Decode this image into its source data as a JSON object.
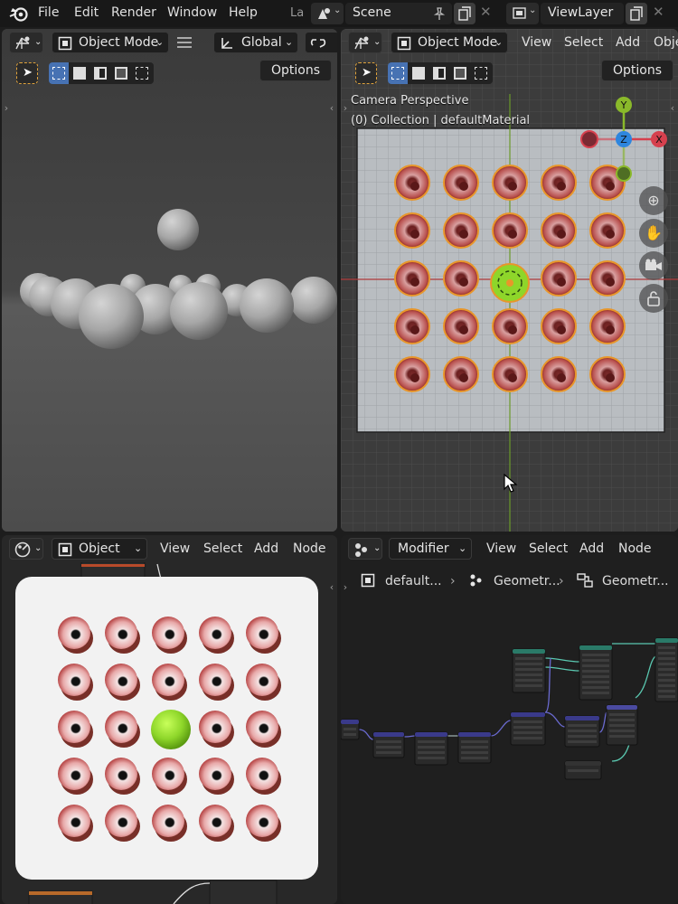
{
  "topbar": {
    "menus": [
      "File",
      "Edit",
      "Render",
      "Window",
      "Help"
    ],
    "workspace_tab": "La",
    "scene": "Scene",
    "view_layer": "ViewLayer"
  },
  "viewport_left": {
    "mode": "Object Mode",
    "orientation": "Global",
    "options": "Options"
  },
  "viewport_right": {
    "mode": "Object Mode",
    "menus": [
      "View",
      "Select",
      "Add",
      "Obje"
    ],
    "options": "Options",
    "overlay_line1": "Camera Perspective",
    "overlay_line2": "(0) Collection | defaultMaterial",
    "gizmo": {
      "y": "Y",
      "z": "Z",
      "x": "X"
    }
  },
  "shader_editor": {
    "context": "Object",
    "menus": [
      "View",
      "Select",
      "Add",
      "Node"
    ]
  },
  "geometry_editor": {
    "context": "Modifier",
    "menus": [
      "View",
      "Select",
      "Add",
      "Node"
    ],
    "breadcrumbs": [
      "default...",
      "Geometr...",
      "Geometr..."
    ]
  },
  "colors": {
    "accent": "#4772b3",
    "selection_orange": "#e8962a",
    "active_green": "#8ed62a",
    "axis_x": "#d6404e",
    "axis_y": "#8ab92a",
    "axis_z": "#2e86de"
  },
  "eye_grid": {
    "rows": 5,
    "cols": 5,
    "center_sphere": "green"
  }
}
